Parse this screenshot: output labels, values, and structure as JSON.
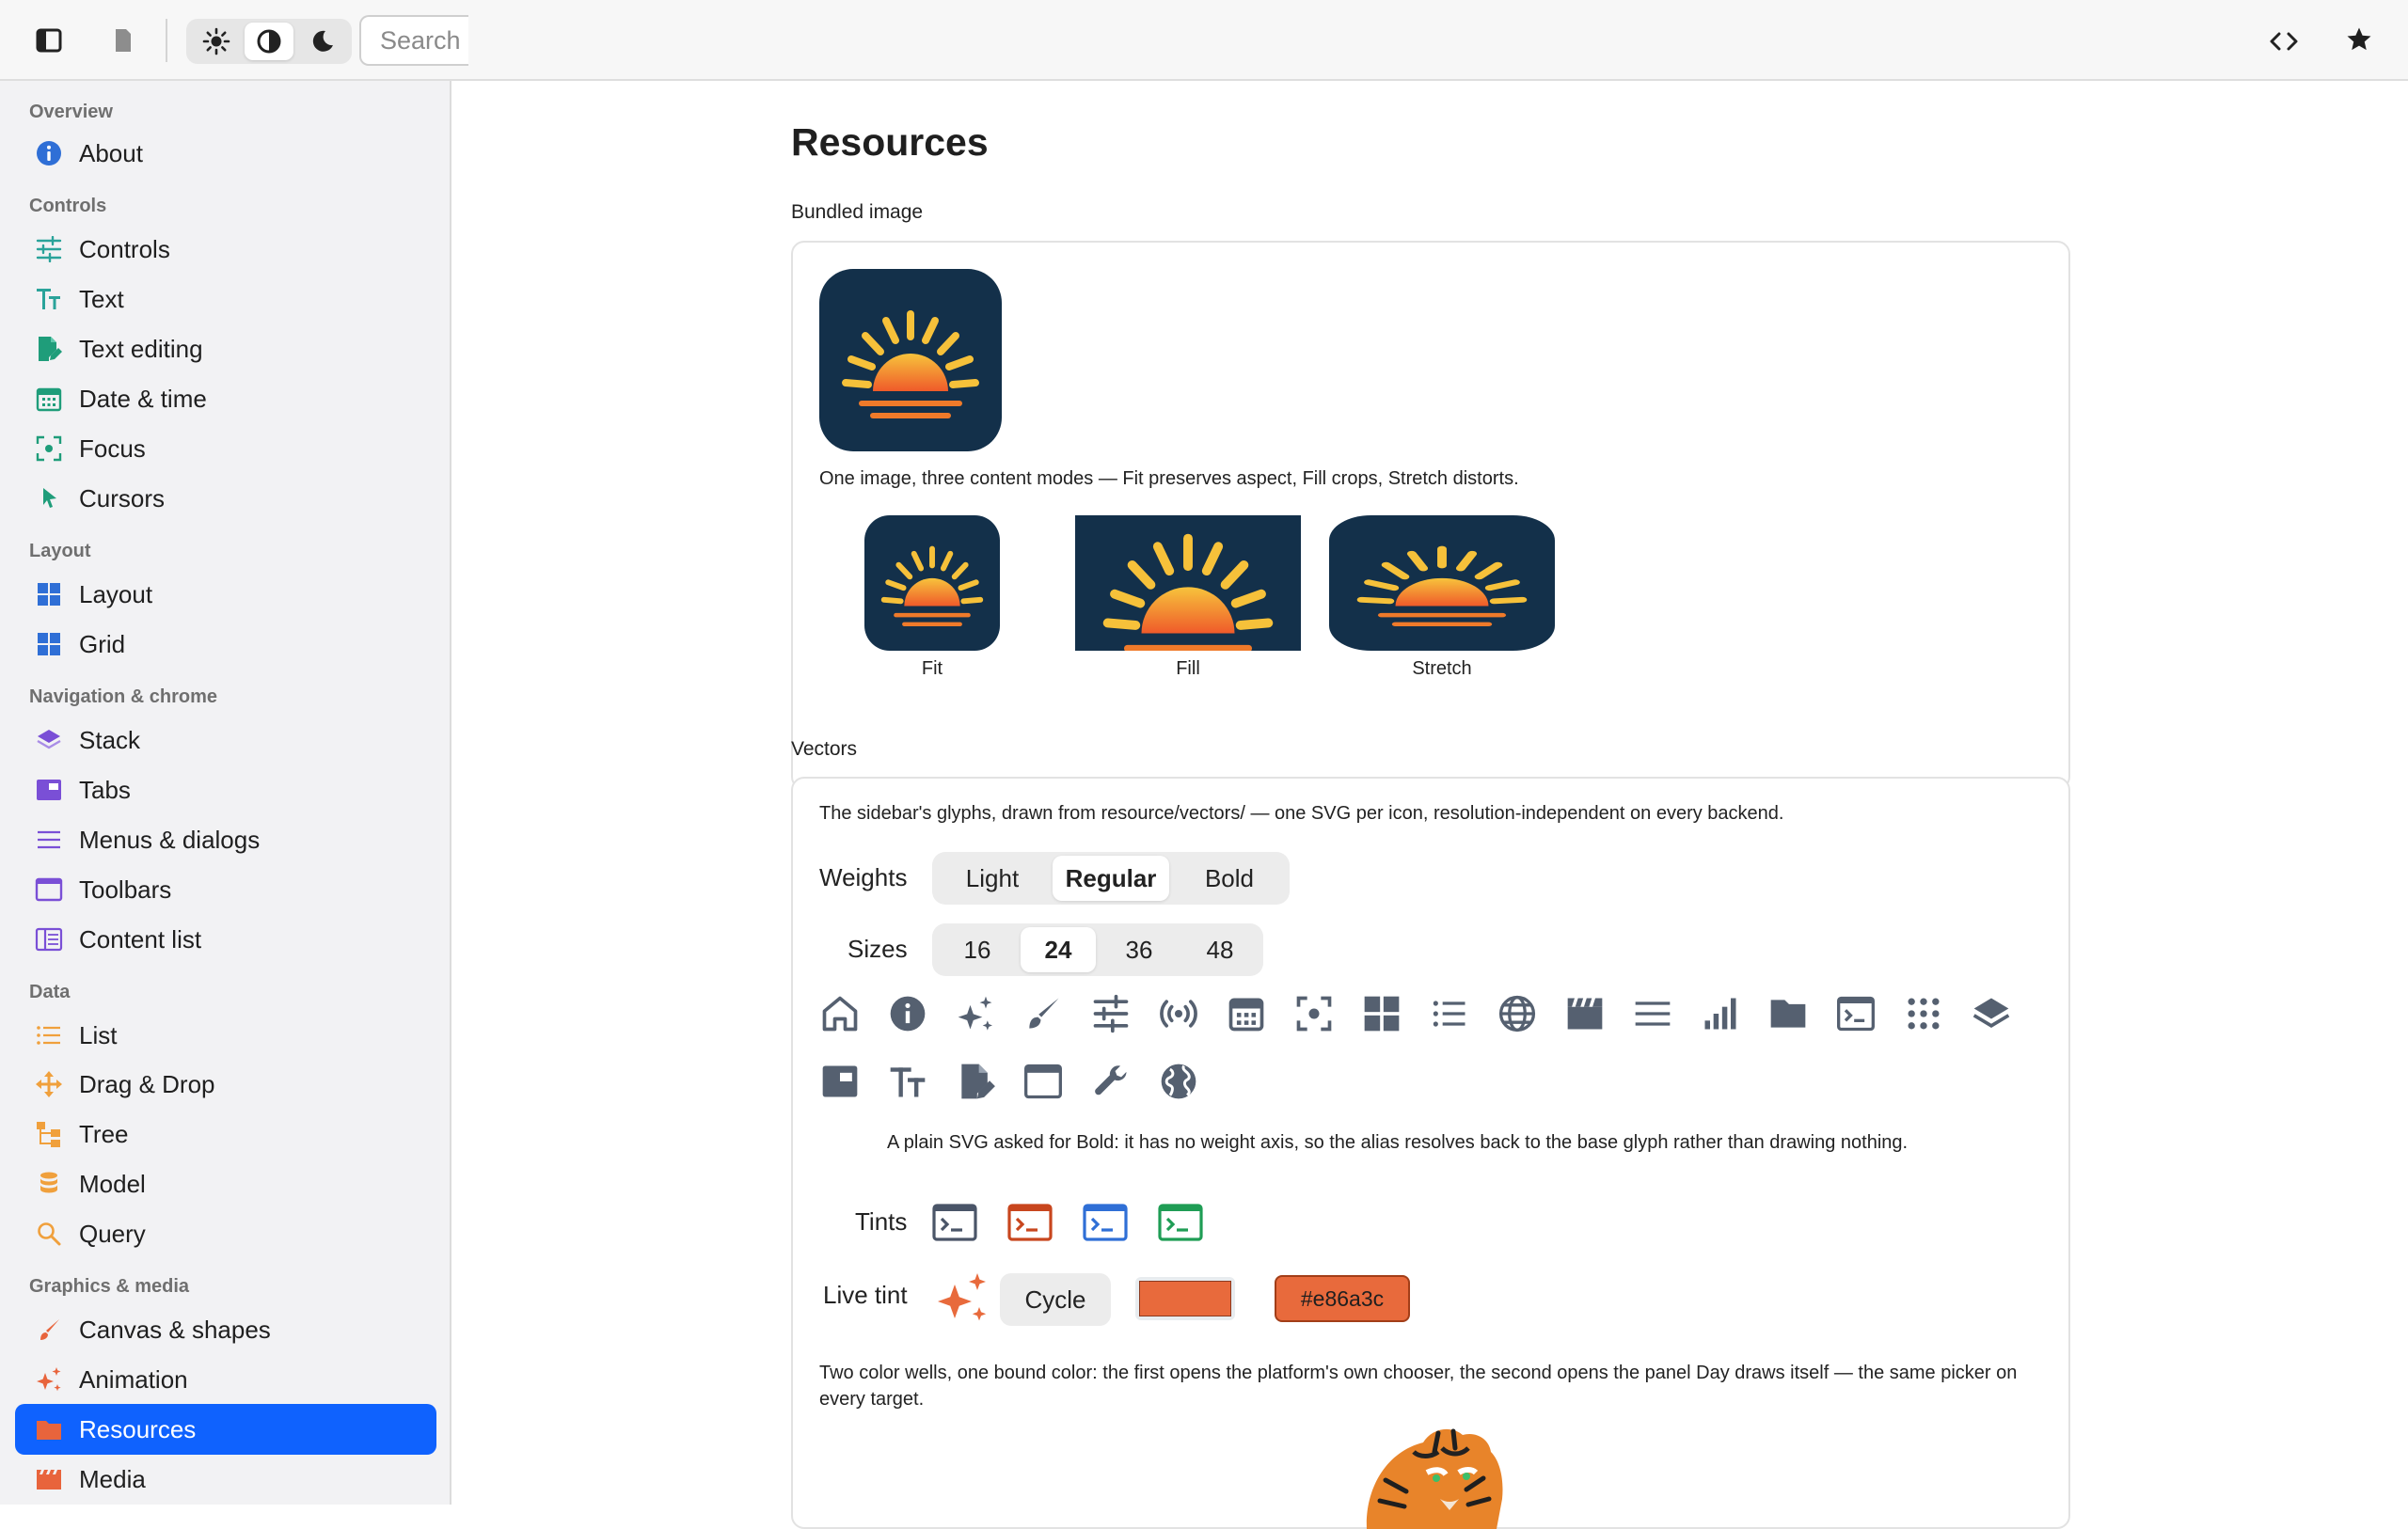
{
  "toolbar": {
    "search_placeholder": "Search"
  },
  "sidebar": {
    "sections": [
      {
        "title": "Overview",
        "items": [
          {
            "label": "About",
            "icon": "info-icon"
          }
        ]
      },
      {
        "title": "Controls",
        "items": [
          {
            "label": "Controls",
            "icon": "sliders-icon"
          },
          {
            "label": "Text",
            "icon": "text-size-icon"
          },
          {
            "label": "Text editing",
            "icon": "file-edit-icon"
          },
          {
            "label": "Date & time",
            "icon": "calendar-icon"
          },
          {
            "label": "Focus",
            "icon": "focus-icon"
          },
          {
            "label": "Cursors",
            "icon": "cursor-icon"
          }
        ]
      },
      {
        "title": "Layout",
        "items": [
          {
            "label": "Layout",
            "icon": "layout-icon"
          },
          {
            "label": "Grid",
            "icon": "grid-icon"
          }
        ]
      },
      {
        "title": "Navigation & chrome",
        "items": [
          {
            "label": "Stack",
            "icon": "stack-icon"
          },
          {
            "label": "Tabs",
            "icon": "tabs-icon"
          },
          {
            "label": "Menus & dialogs",
            "icon": "menu-icon"
          },
          {
            "label": "Toolbars",
            "icon": "window-icon"
          },
          {
            "label": "Content list",
            "icon": "content-list-icon"
          }
        ]
      },
      {
        "title": "Data",
        "items": [
          {
            "label": "List",
            "icon": "list-icon"
          },
          {
            "label": "Drag & Drop",
            "icon": "move-icon"
          },
          {
            "label": "Tree",
            "icon": "tree-icon"
          },
          {
            "label": "Model",
            "icon": "database-icon"
          },
          {
            "label": "Query",
            "icon": "search-icon"
          }
        ]
      },
      {
        "title": "Graphics & media",
        "items": [
          {
            "label": "Canvas & shapes",
            "icon": "brush-icon"
          },
          {
            "label": "Animation",
            "icon": "sparkle-icon"
          },
          {
            "label": "Resources",
            "icon": "folder-icon",
            "selected": true
          },
          {
            "label": "Media",
            "icon": "film-icon"
          }
        ]
      }
    ]
  },
  "main": {
    "title": "Resources",
    "bundled": {
      "caption": "Bundled image",
      "description": "One image, three content modes — Fit preserves aspect, Fill crops, Stretch distorts.",
      "modes": [
        "Fit",
        "Fill",
        "Stretch"
      ]
    },
    "vectors": {
      "caption": "Vectors",
      "description": "The sidebar's glyphs, drawn from resource/vectors/ — one SVG per icon, resolution-independent on every backend.",
      "weights_label": "Weights",
      "weights": [
        "Light",
        "Regular",
        "Bold"
      ],
      "weights_selected": "Regular",
      "sizes_label": "Sizes",
      "sizes": [
        "16",
        "24",
        "36",
        "48"
      ],
      "sizes_selected": "24",
      "bold_note": "A plain SVG asked for Bold: it has no weight axis, so the alias resolves back to the base glyph rather than drawing nothing.",
      "tints_label": "Tints",
      "tint_colors": [
        "#4a5568",
        "#c8461e",
        "#2f6fd6",
        "#1f9d55"
      ],
      "live_tint_label": "Live tint",
      "cycle_label": "Cycle",
      "live_color": "#e86a3c",
      "live_color_text": "#e86a3c",
      "wells_note": "Two color wells, one bound color: the first opens the platform's own chooser, the second opens the panel Day draws itself — the same picker on every target."
    },
    "glyphs": [
      "home-icon",
      "info-icon",
      "sparkle-icon",
      "brush-icon",
      "sliders-icon",
      "broadcast-icon",
      "calendar-icon",
      "focus-icon",
      "grid-icon",
      "list-icon",
      "globe-icon",
      "film-icon",
      "menu-icon",
      "signal-icon",
      "folder-icon",
      "terminal-icon",
      "dots-grid-icon",
      "stack-icon",
      "tabs-icon",
      "text-size-icon",
      "file-edit-icon",
      "window-icon",
      "wrench-icon",
      "globe-filled-icon"
    ]
  }
}
